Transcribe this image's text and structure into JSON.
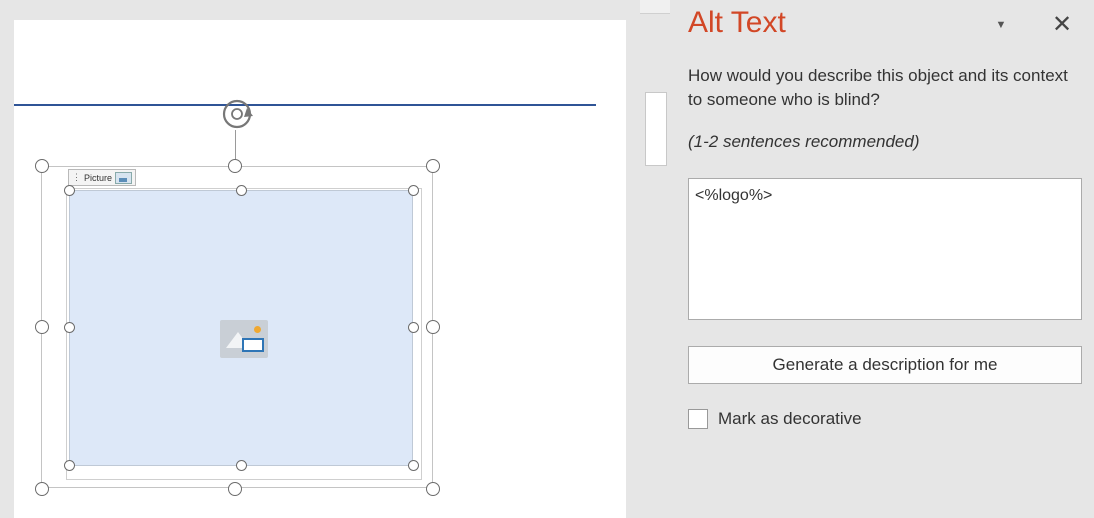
{
  "document": {
    "content_control": {
      "label": "Picture",
      "grip": "⋮",
      "icon": "picture-icon"
    },
    "rotate_icon": "rotate-icon",
    "placeholder_icon": "image-placeholder-icon"
  },
  "pane": {
    "title": "Alt Text",
    "menu_glyph": "▼",
    "close_glyph": "✕",
    "prompt": "How would you describe this object and its context to someone who is blind?",
    "hint": "(1-2 sentences recommended)",
    "alt_text_value": "<%logo%>",
    "generate_label": "Generate a description for me",
    "decorative_label": "Mark as decorative",
    "decorative_checked": false
  },
  "colors": {
    "title": "#d24726",
    "header_rule": "#2f5496",
    "picture_fill": "#dde8f8"
  }
}
